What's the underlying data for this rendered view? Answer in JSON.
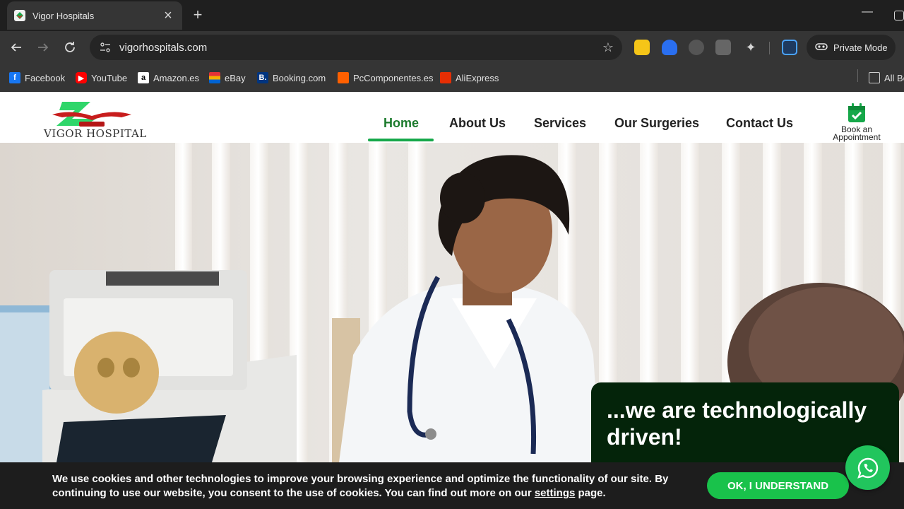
{
  "browser": {
    "tab_title": "Vigor Hospitals",
    "url": "vigorhospitals.com",
    "private_mode_label": "Private Mode",
    "bookmarks": [
      {
        "label": "Facebook",
        "icon": "facebook-icon",
        "color": "#1877f2"
      },
      {
        "label": "YouTube",
        "icon": "youtube-icon",
        "color": "#ff0000"
      },
      {
        "label": "Amazon.es",
        "icon": "amazon-icon",
        "color": "#ffffff"
      },
      {
        "label": "eBay",
        "icon": "ebay-icon",
        "color": "#e53238"
      },
      {
        "label": "Booking.com",
        "icon": "booking-icon",
        "color": "#003580"
      },
      {
        "label": "PcComponentes.es",
        "icon": "pccomponentes-icon",
        "color": "#ff6000"
      },
      {
        "label": "AliExpress",
        "icon": "aliexpress-icon",
        "color": "#e62e04"
      }
    ],
    "all_bookmarks_label": "All Bo"
  },
  "site": {
    "logo_text": "VIGOR HOSPITAL",
    "nav": [
      {
        "label": "Home",
        "active": true
      },
      {
        "label": "About Us"
      },
      {
        "label": "Services"
      },
      {
        "label": "Our Surgeries"
      },
      {
        "label": "Contact Us"
      }
    ],
    "appointment": {
      "line1": "Book an",
      "line2": "Appointment"
    },
    "tagline_line1": "...we are technologically",
    "tagline_line2": "driven!",
    "brand_color": "#16a84a",
    "tagline_bg": "#04240a"
  },
  "cookie": {
    "text_before_link": "We use cookies and other technologies to improve your browsing experience and optimize the functionality of our site. By continuing to use our website, you consent to the use of cookies. You can find out more on our ",
    "link_text": "settings",
    "text_after_link": " page.",
    "button_label": "OK, I UNDERSTAND"
  }
}
